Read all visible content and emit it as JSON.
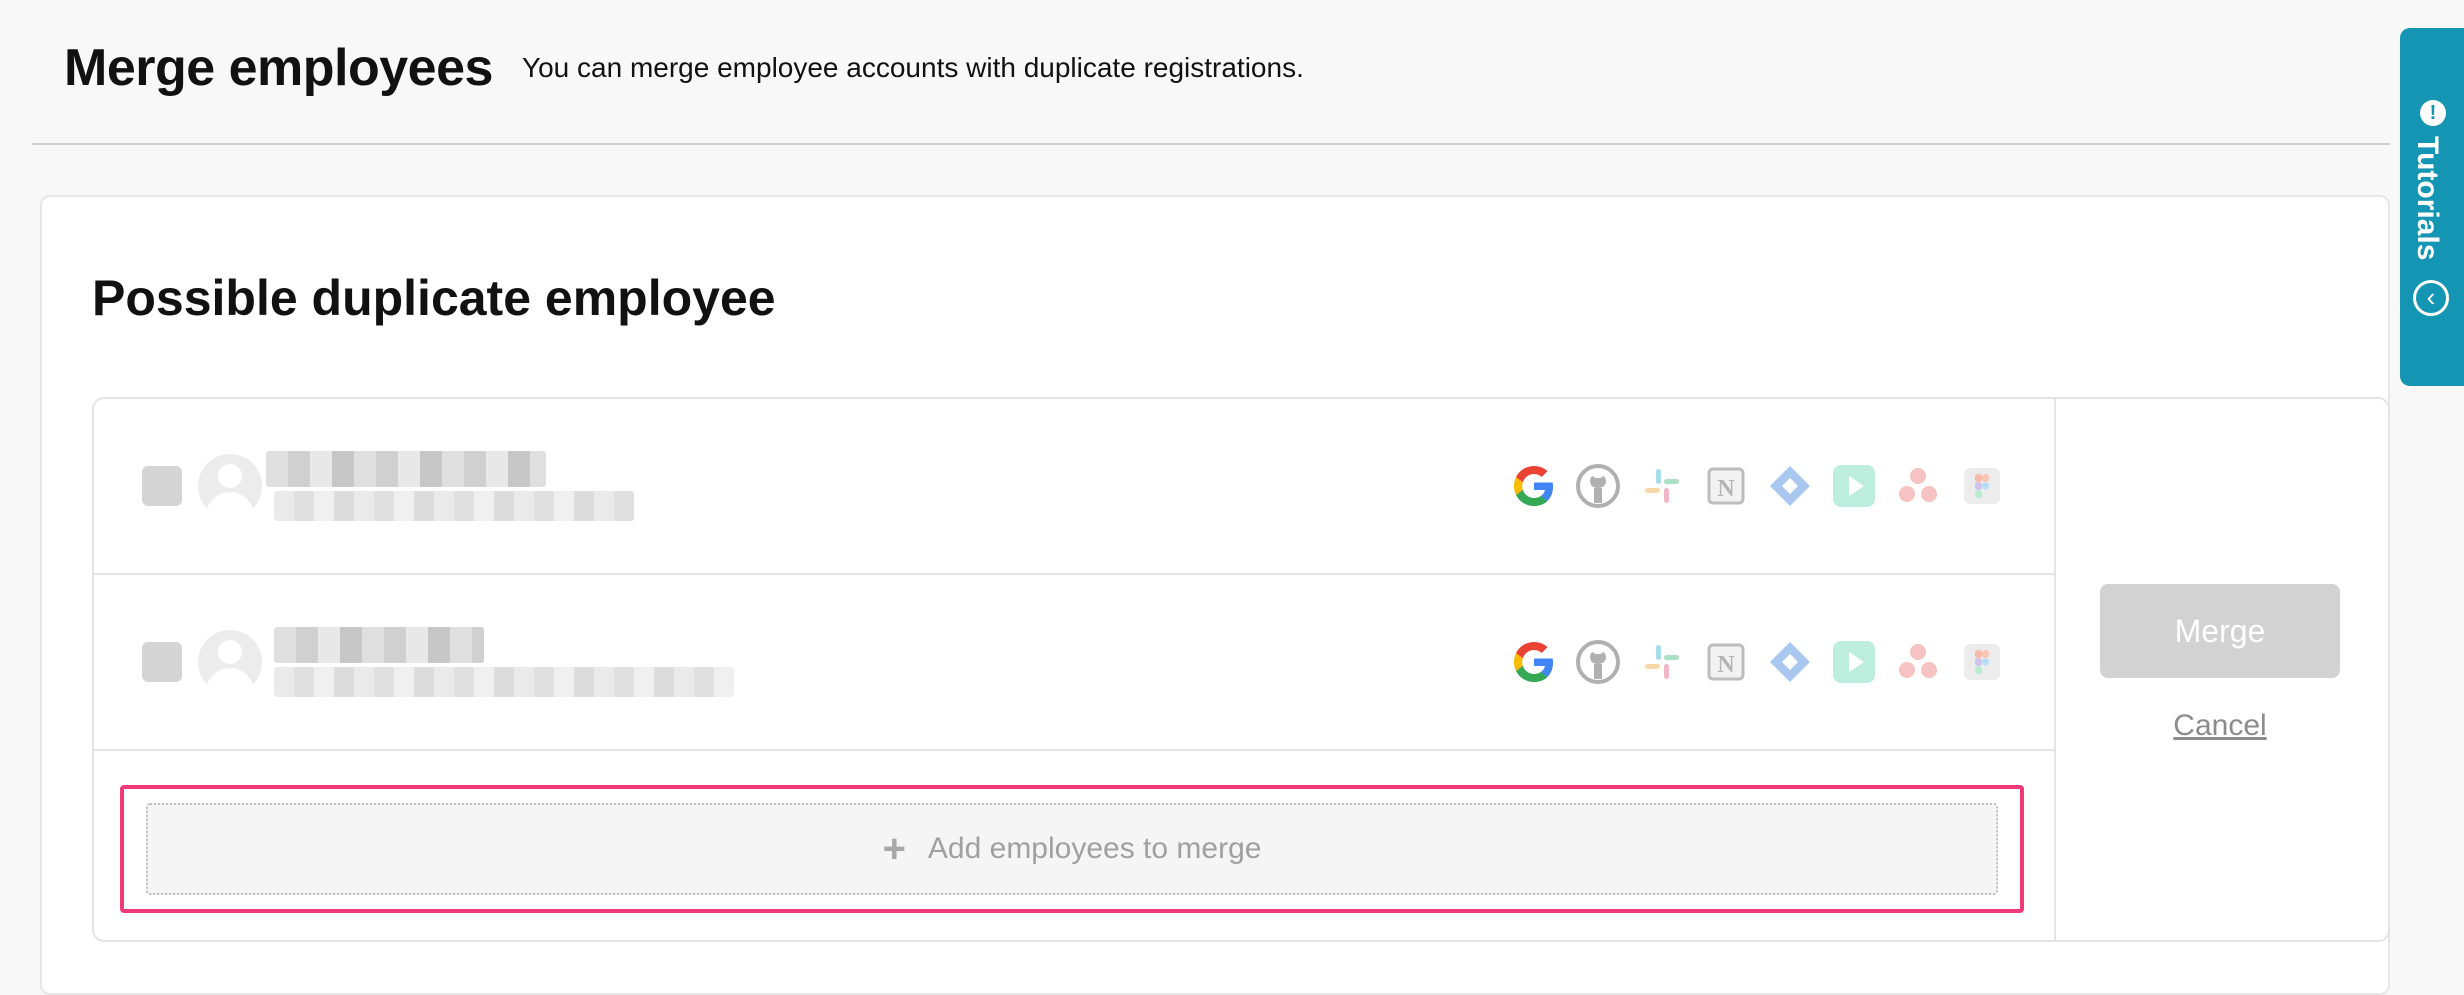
{
  "header": {
    "title": "Merge employees",
    "description": "You can merge employee accounts with duplicate registrations."
  },
  "section": {
    "title": "Possible duplicate employee"
  },
  "employees": [
    {
      "name": "",
      "email": "",
      "services": [
        "google-icon",
        "github-icon",
        "slack-icon",
        "notion-icon",
        "jira-icon",
        "play-app-icon",
        "asana-icon",
        "figma-icon"
      ]
    },
    {
      "name": "",
      "email": "",
      "services": [
        "google-icon",
        "github-icon",
        "slack-icon",
        "notion-icon",
        "jira-icon",
        "play-app-icon",
        "asana-icon",
        "figma-icon"
      ]
    }
  ],
  "actions": {
    "add_label": "Add employees to merge",
    "add_icon": "+",
    "merge_label": "Merge",
    "cancel_label": "Cancel"
  },
  "tutorials": {
    "label": "Tutorials",
    "info_icon": "!",
    "collapse_icon": "‹"
  },
  "colors": {
    "accent": "#1495b3",
    "highlight": "#ee3a7a",
    "disabled": "#d2d2d2"
  }
}
